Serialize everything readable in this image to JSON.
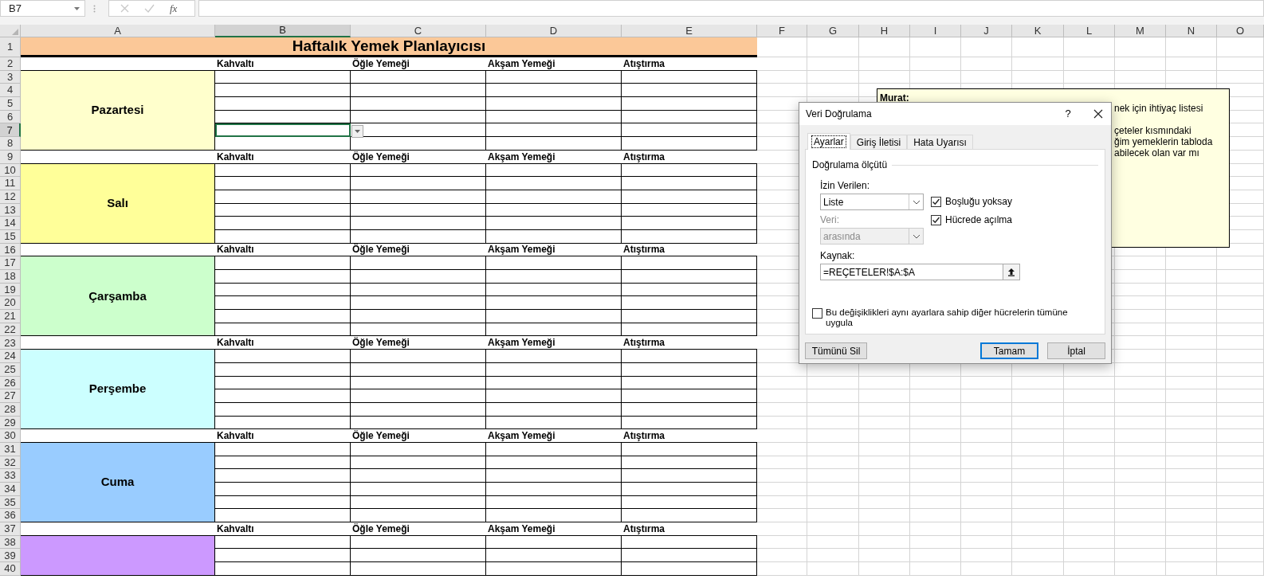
{
  "name_box": "B7",
  "formula_bar": {
    "function_label": "fx"
  },
  "columns": [
    {
      "label": "A",
      "selected": false
    },
    {
      "label": "B",
      "selected": true
    },
    {
      "label": "C",
      "selected": false
    },
    {
      "label": "D",
      "selected": false
    },
    {
      "label": "E",
      "selected": false
    },
    {
      "label": "F",
      "selected": false
    },
    {
      "label": "G",
      "selected": false
    },
    {
      "label": "H",
      "selected": false
    },
    {
      "label": "I",
      "selected": false
    },
    {
      "label": "J",
      "selected": false
    },
    {
      "label": "K",
      "selected": false
    },
    {
      "label": "L",
      "selected": false
    },
    {
      "label": "M",
      "selected": false
    },
    {
      "label": "N",
      "selected": false
    },
    {
      "label": "O",
      "selected": false
    }
  ],
  "rows": [
    {
      "label": "1",
      "selected": false
    },
    {
      "label": "2",
      "selected": false
    },
    {
      "label": "3",
      "selected": false
    },
    {
      "label": "4",
      "selected": false
    },
    {
      "label": "5",
      "selected": false
    },
    {
      "label": "6",
      "selected": false
    },
    {
      "label": "7",
      "selected": true
    },
    {
      "label": "8",
      "selected": false
    },
    {
      "label": "9",
      "selected": false
    },
    {
      "label": "10",
      "selected": false
    },
    {
      "label": "11",
      "selected": false
    },
    {
      "label": "12",
      "selected": false
    },
    {
      "label": "13",
      "selected": false
    },
    {
      "label": "14",
      "selected": false
    },
    {
      "label": "15",
      "selected": false
    },
    {
      "label": "16",
      "selected": false
    },
    {
      "label": "17",
      "selected": false
    },
    {
      "label": "18",
      "selected": false
    },
    {
      "label": "19",
      "selected": false
    },
    {
      "label": "20",
      "selected": false
    },
    {
      "label": "21",
      "selected": false
    },
    {
      "label": "22",
      "selected": false
    },
    {
      "label": "23",
      "selected": false
    },
    {
      "label": "24",
      "selected": false
    },
    {
      "label": "25",
      "selected": false
    },
    {
      "label": "26",
      "selected": false
    },
    {
      "label": "27",
      "selected": false
    },
    {
      "label": "28",
      "selected": false
    },
    {
      "label": "29",
      "selected": false
    },
    {
      "label": "30",
      "selected": false
    },
    {
      "label": "31",
      "selected": false
    },
    {
      "label": "32",
      "selected": false
    },
    {
      "label": "33",
      "selected": false
    },
    {
      "label": "34",
      "selected": false
    },
    {
      "label": "35",
      "selected": false
    },
    {
      "label": "36",
      "selected": false
    },
    {
      "label": "37",
      "selected": false
    },
    {
      "label": "38",
      "selected": false
    },
    {
      "label": "39",
      "selected": false
    },
    {
      "label": "40",
      "selected": false
    }
  ],
  "active_cell": {
    "dropdown": true
  },
  "title": "Haftalık Yemek Planlayıcısı",
  "days": [
    {
      "name": "Pazartesi",
      "color": "#ffffcc",
      "meals": [
        "Kahvaltı",
        "Öğle Yemeği",
        "Akşam Yemeği",
        "Atıştırma"
      ]
    },
    {
      "name": "Salı",
      "color": "#ffff99",
      "meals": [
        "Kahvaltı",
        "Öğle Yemeği",
        "Akşam Yemeği",
        "Atıştırma"
      ]
    },
    {
      "name": "Çarşamba",
      "color": "#ccffcc",
      "meals": [
        "Kahvaltı",
        "Öğle Yemeği",
        "Akşam Yemeği",
        "Atıştırma"
      ]
    },
    {
      "name": "Perşembe",
      "color": "#ccffff",
      "meals": [
        "Kahvaltı",
        "Öğle Yemeği",
        "Akşam Yemeği",
        "Atıştırma"
      ]
    },
    {
      "name": "Cuma",
      "color": "#99ccff",
      "meals": [
        "Kahvaltı",
        "Öğle Yemeği",
        "Akşam Yemeği",
        "Atıştırma"
      ]
    },
    {
      "color": "#cc99ff",
      "meals": [
        "Kahvaltı",
        "Öğle Yemeği",
        "Akşam Yemeği",
        "Atıştırma"
      ]
    }
  ],
  "comment": {
    "author": "Murat:",
    "paragraphs": [
      [
        "nek için ihtiyaç listesi"
      ],
      [
        "çeteler kısmındaki",
        "ğim yemeklerin tabloda",
        "abilecek olan var mı"
      ]
    ]
  },
  "dialog": {
    "title": "Veri Doğrulama",
    "help": "?",
    "tabs": [
      {
        "label": "Ayarlar",
        "selected": true
      },
      {
        "label": "Giriş İletisi",
        "selected": false
      },
      {
        "label": "Hata Uyarısı",
        "selected": false
      }
    ],
    "group_label": "Doğrulama ölçütü",
    "allow": {
      "label": "İzin Verilen:",
      "value": "Liste",
      "disabled": false
    },
    "data": {
      "label": "Veri:",
      "value": "arasında",
      "disabled": true
    },
    "checkboxes": [
      {
        "label": "Boşluğu yoksay",
        "checked": true
      },
      {
        "label": "Hücrede açılma",
        "checked": true
      }
    ],
    "source": {
      "label": "Kaynak:",
      "value": "=REÇETELER!$A:$A"
    },
    "apply_all": {
      "label": "Bu değişiklikleri aynı ayarlara sahip diğer hücrelerin tümüne uygula",
      "checked": false
    },
    "buttons": [
      {
        "label": "Tümünü Sil",
        "default": false
      },
      {
        "label": "Tamam",
        "default": true
      },
      {
        "label": "İptal",
        "default": false
      }
    ]
  }
}
